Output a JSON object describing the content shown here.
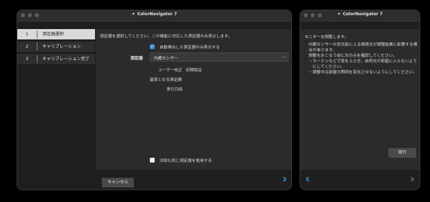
{
  "app": {
    "title": "ColorNavigator 7"
  },
  "main": {
    "nav": [
      {
        "num": "1",
        "label": "測定器選択"
      },
      {
        "num": "2",
        "label": "キャリブレーション"
      },
      {
        "num": "3",
        "label": "キャリブレーション完了"
      }
    ],
    "instruction": "測定器を選択してください。この機能に対応した測定器のみ表示します。",
    "detected_only": {
      "label": "自動検出した測定器のみ表示する",
      "checked": true
    },
    "device_label": "測定器",
    "device_selected": "内蔵センサー",
    "calibration_label": "ユーザー校正",
    "calibration_value": "初期設定",
    "reference_label": "基準となる測定器",
    "date_label": "実行日時",
    "use_next_time": {
      "label": "次回も同じ測定器を使用する",
      "checked": false
    },
    "cancel_label": "キャンセル",
    "next_arrow": "›"
  },
  "side": {
    "title": "ColorNavigator 7",
    "heading": "モニターを調整します。",
    "lines": [
      "内蔵センサーの受光部に入る環境光が調整結果に影響する場",
      "合があります。",
      "調整をおこなう前に次の点を確認してください。",
      "・カーテンなどで窓をふさぎ、自然光が部屋に入らないよう",
      "　にしてください。",
      "・調整中は部屋の照明を変化させないようにしてください。"
    ],
    "exec_label": "実行",
    "back_arrow": "‹",
    "forward_arrow": "›"
  },
  "colors": {
    "accent": "#2a9be6",
    "checkbox": "#3d8fd6"
  }
}
